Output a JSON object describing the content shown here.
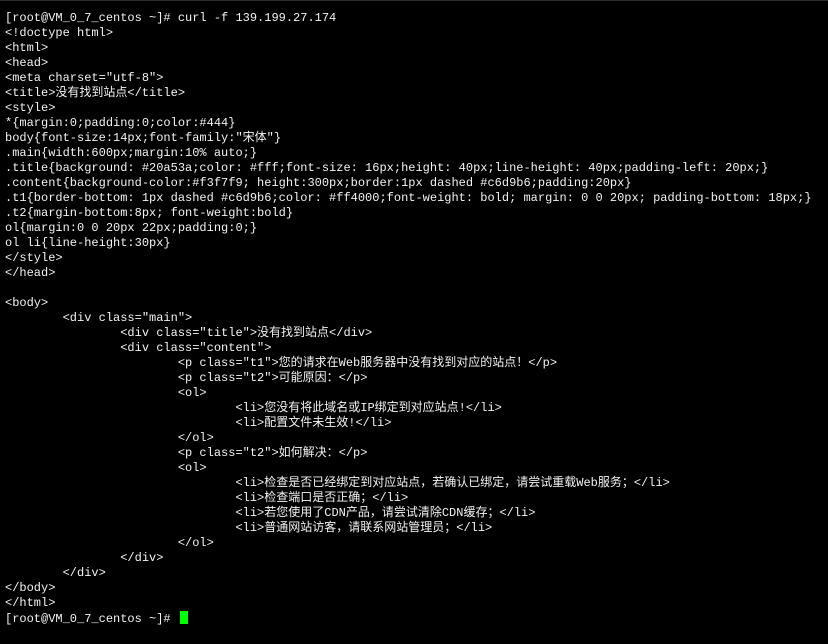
{
  "terminal": {
    "lines": [
      "[root@VM_0_7_centos ~]# curl -f 139.199.27.174",
      "<!doctype html>",
      "<html>",
      "<head>",
      "<meta charset=\"utf-8\">",
      "<title>没有找到站点</title>",
      "<style>",
      "*{margin:0;padding:0;color:#444}",
      "body{font-size:14px;font-family:\"宋体\"}",
      ".main{width:600px;margin:10% auto;}",
      ".title{background: #20a53a;color: #fff;font-size: 16px;height: 40px;line-height: 40px;padding-left: 20px;}",
      ".content{background-color:#f3f7f9; height:300px;border:1px dashed #c6d9b6;padding:20px}",
      ".t1{border-bottom: 1px dashed #c6d9b6;color: #ff4000;font-weight: bold; margin: 0 0 20px; padding-bottom: 18px;}",
      ".t2{margin-bottom:8px; font-weight:bold}",
      "ol{margin:0 0 20px 22px;padding:0;}",
      "ol li{line-height:30px}",
      "</style>",
      "</head>",
      "",
      "<body>",
      "        <div class=\"main\">",
      "                <div class=\"title\">没有找到站点</div>",
      "                <div class=\"content\">",
      "                        <p class=\"t1\">您的请求在Web服务器中没有找到对应的站点！</p>",
      "                        <p class=\"t2\">可能原因：</p>",
      "                        <ol>",
      "                                <li>您没有将此域名或IP绑定到对应站点!</li>",
      "                                <li>配置文件未生效!</li>",
      "                        </ol>",
      "                        <p class=\"t2\">如何解决：</p>",
      "                        <ol>",
      "                                <li>检查是否已经绑定到对应站点，若确认已绑定，请尝试重载Web服务；</li>",
      "                                <li>检查端口是否正确；</li>",
      "                                <li>若您使用了CDN产品，请尝试清除CDN缓存；</li>",
      "                                <li>普通网站访客，请联系网站管理员；</li>",
      "                        </ol>",
      "                </div>",
      "        </div>",
      "</body>",
      "</html>"
    ],
    "prompt": "[root@VM_0_7_centos ~]# ",
    "cursor_color": "#00ff00",
    "background_color": "#000000",
    "text_color": "#f2f2f2"
  }
}
